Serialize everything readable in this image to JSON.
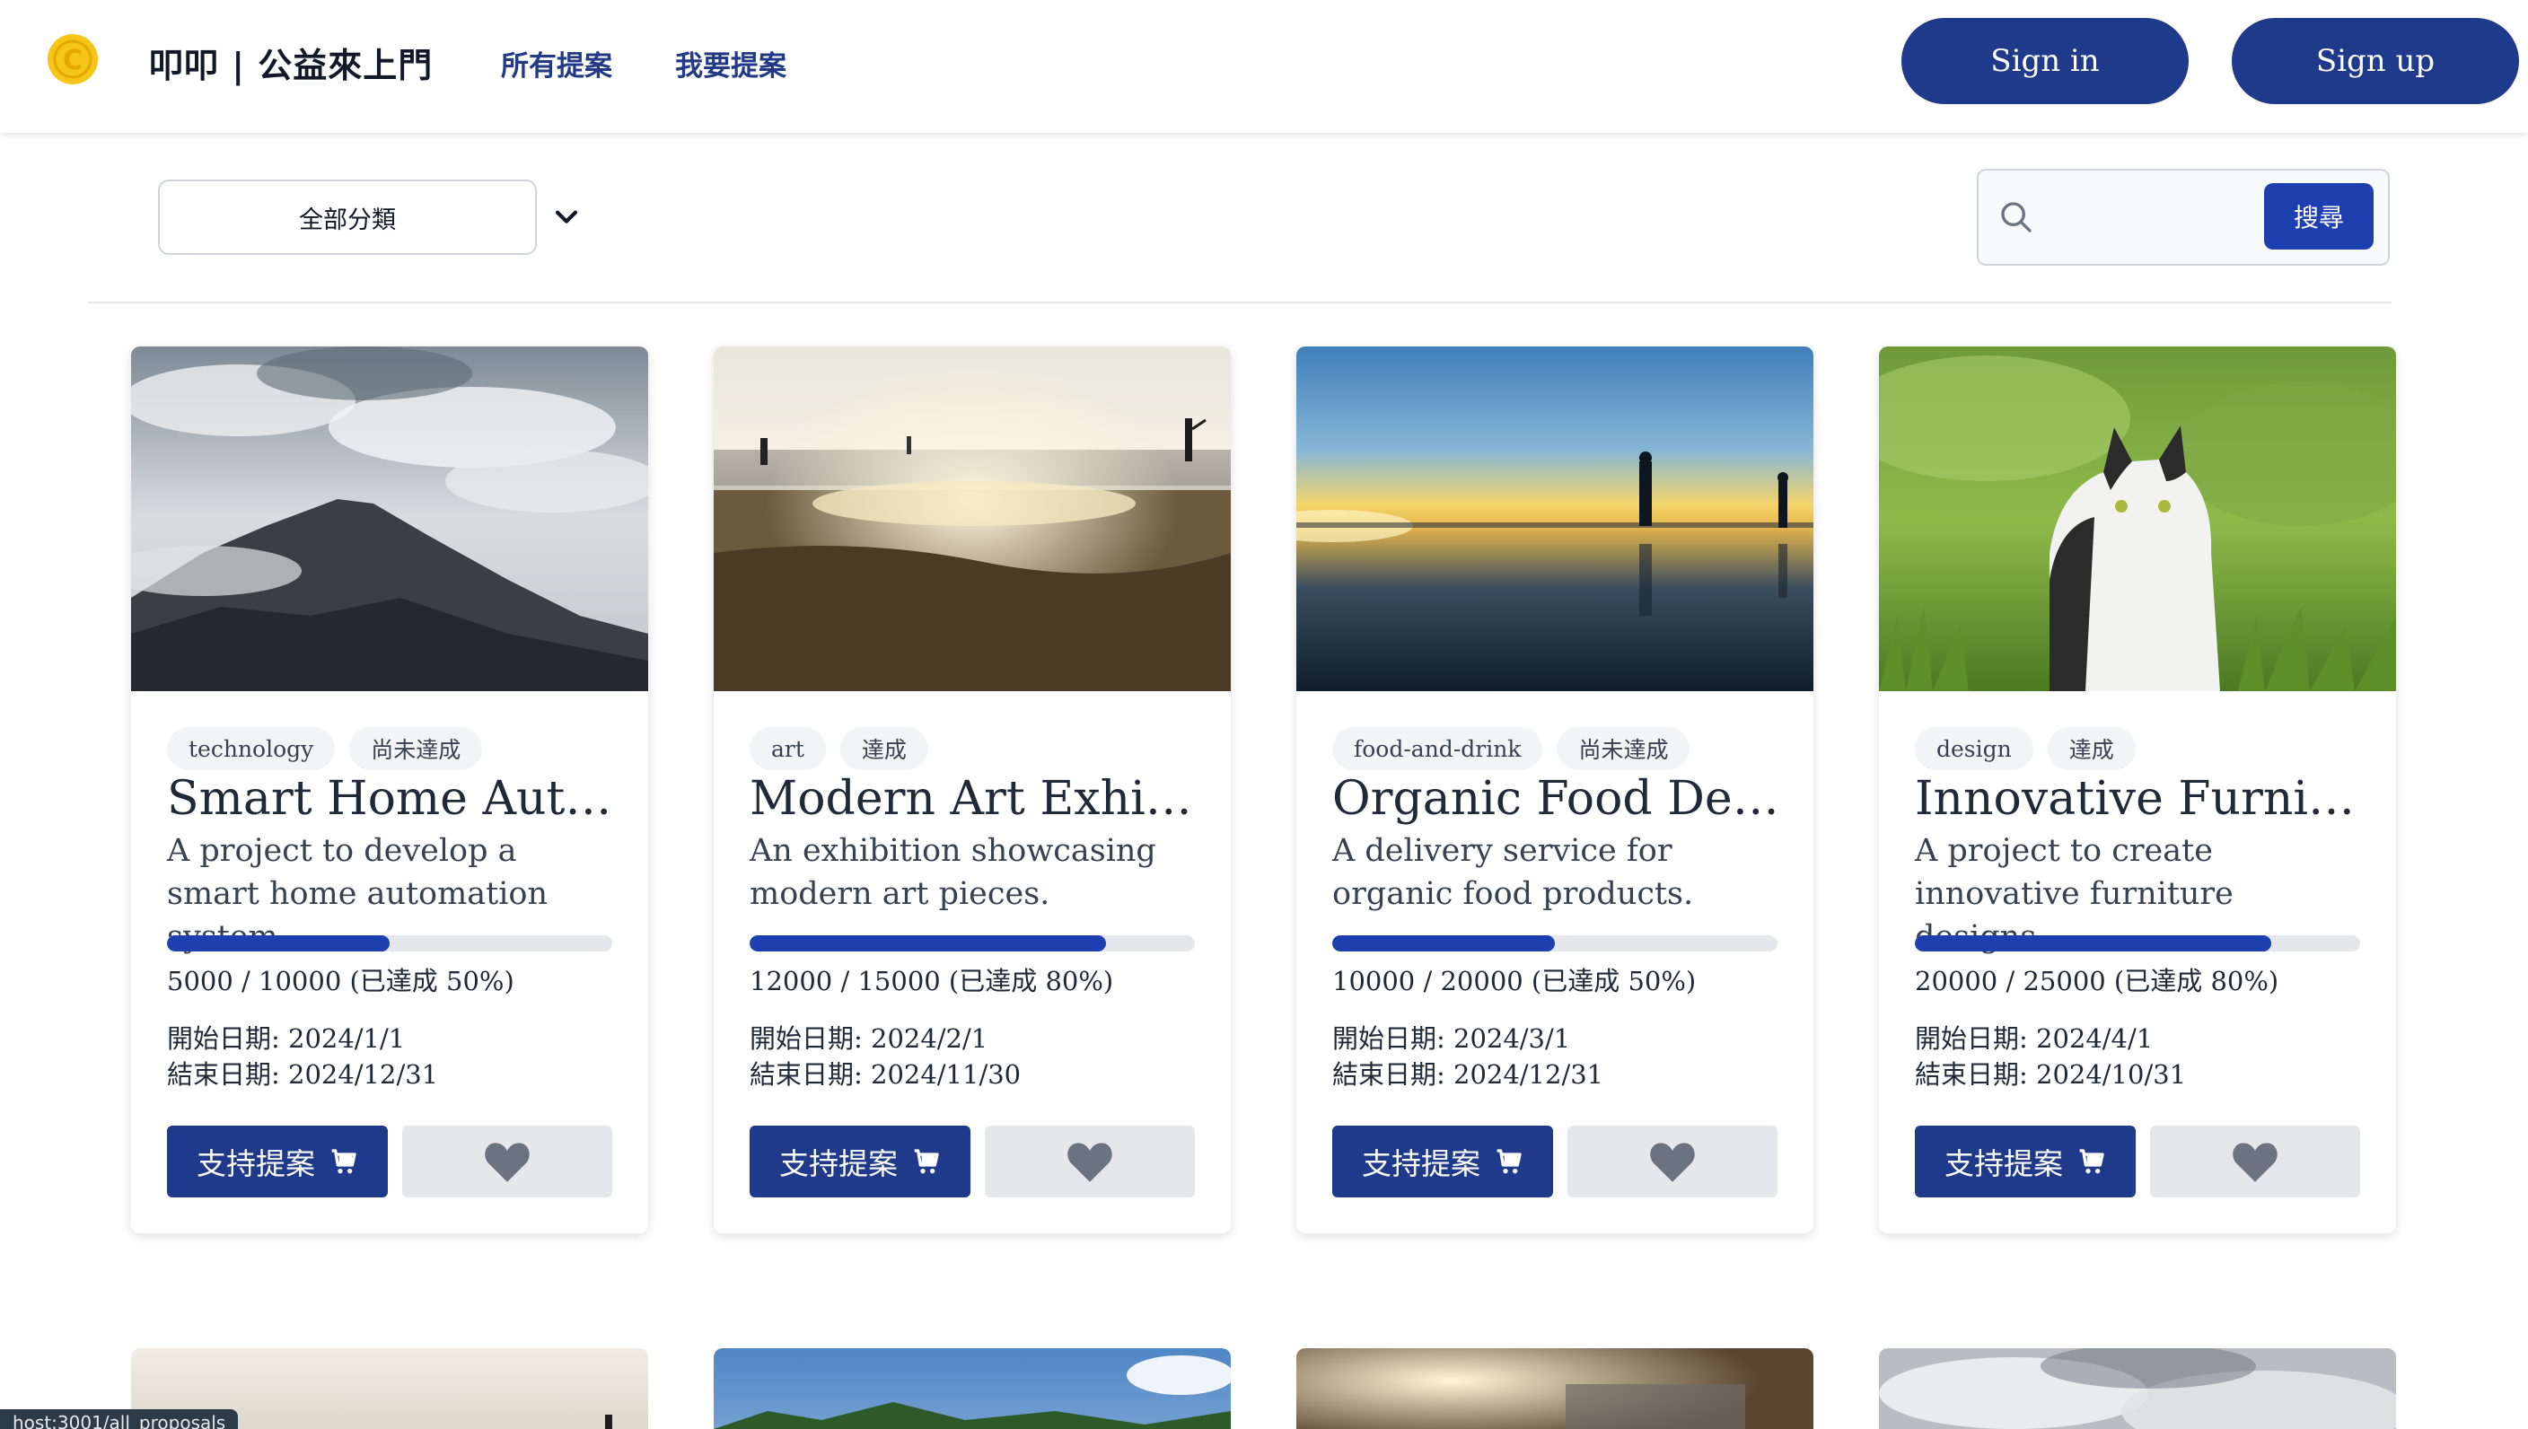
{
  "header": {
    "brand": "叩叩 | 公益來上門",
    "nav": [
      "所有提案",
      "我要提案"
    ],
    "sign_in": "Sign in",
    "sign_up": "Sign up",
    "logo_color": "#f5c518"
  },
  "filters": {
    "category_selected": "全部分類",
    "search_placeholder": "",
    "search_button": "搜尋"
  },
  "colors": {
    "primary": "#1f3a8a",
    "progress": "#1d3fb0",
    "tag_bg": "#f3f4f6"
  },
  "cards": [
    {
      "category": "technology",
      "status": "尚未達成",
      "title": "Smart Home Automation",
      "description": "A project to develop a smart home automation system.",
      "progress_text": "5000 / 10000 (已達成 50%)",
      "progress_fraction": 0.5,
      "start_date": "開始日期: 2024/1/1",
      "end_date": "結束日期: 2024/12/31",
      "support_label": "支持提案",
      "image": "cloudy mountain"
    },
    {
      "category": "art",
      "status": "達成",
      "title": "Modern Art Exhibition",
      "description": "An exhibition showcasing modern art pieces.",
      "progress_text": "12000 / 15000 (已達成 80%)",
      "progress_fraction": 0.8,
      "start_date": "開始日期: 2024/2/1",
      "end_date": "結束日期: 2024/11/30",
      "support_label": "支持提案",
      "image": "sunset beach with people"
    },
    {
      "category": "food-and-drink",
      "status": "尚未達成",
      "title": "Organic Food Delivery",
      "description": "A delivery service for organic food products.",
      "progress_text": "10000 / 20000 (已達成 50%)",
      "progress_fraction": 0.5,
      "start_date": "開始日期: 2024/3/1",
      "end_date": "結束日期: 2024/12/31",
      "support_label": "支持提案",
      "image": "silhouettes on shore at dusk"
    },
    {
      "category": "design",
      "status": "達成",
      "title": "Innovative Furniture",
      "description": "A project to create innovative furniture designs.",
      "progress_text": "20000 / 25000 (已達成 80%)",
      "progress_fraction": 0.8,
      "start_date": "開始日期: 2024/4/1",
      "end_date": "結束日期: 2024/10/31",
      "support_label": "支持提案",
      "image": "cat in grass"
    }
  ],
  "status_url": "host:3001/all_proposals"
}
